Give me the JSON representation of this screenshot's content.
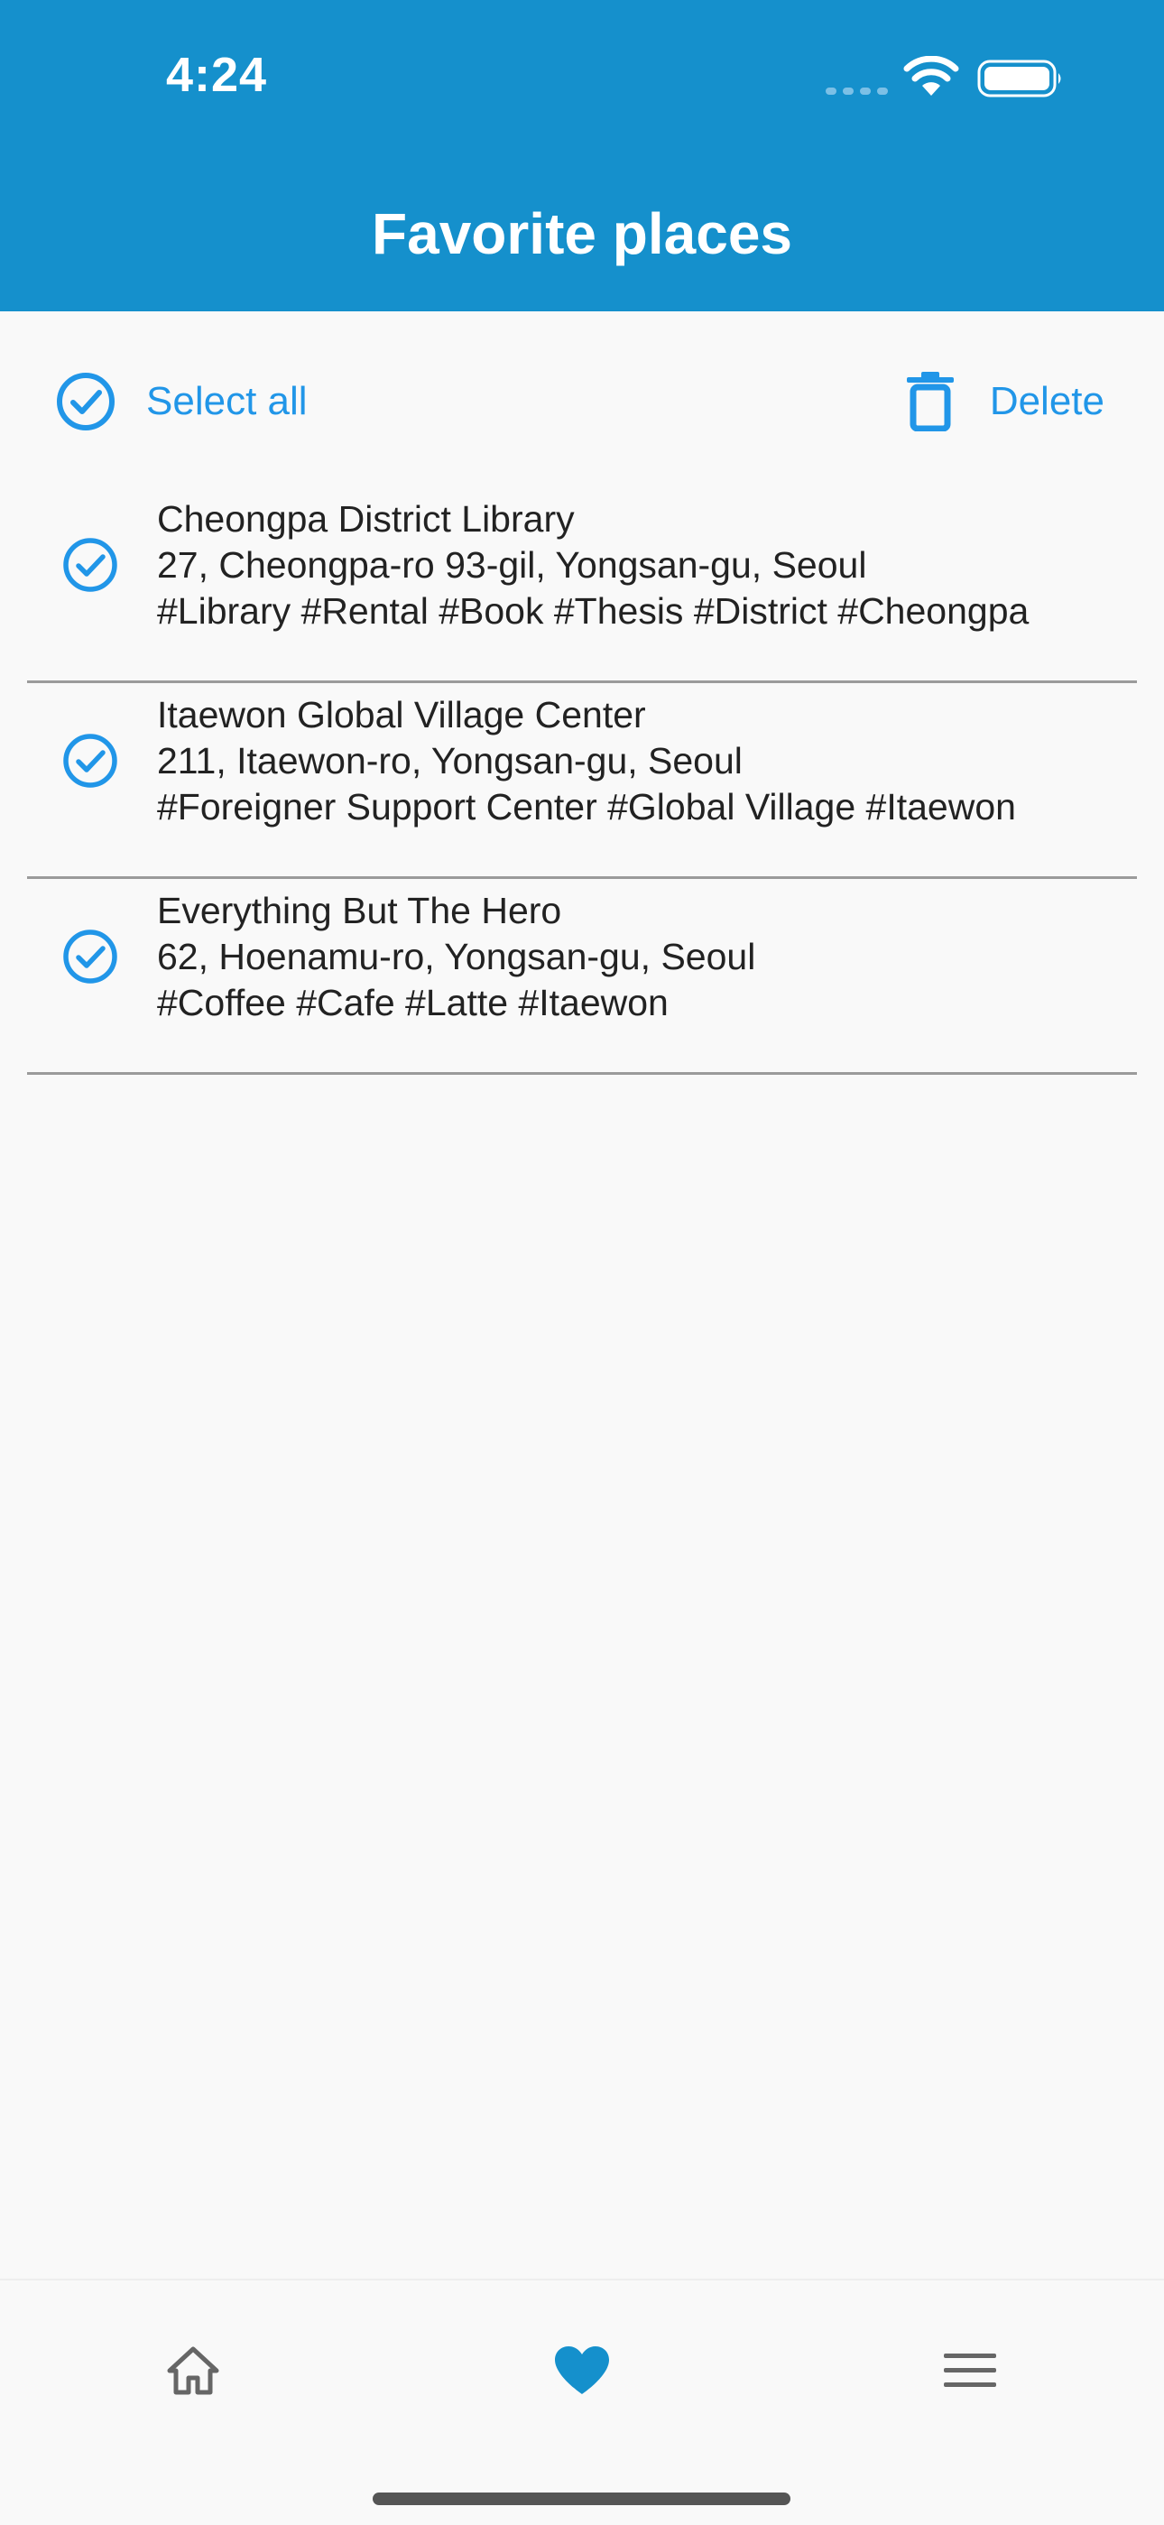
{
  "status_bar": {
    "time": "4:24"
  },
  "header": {
    "title": "Favorite places"
  },
  "toolbar": {
    "select_all_label": "Select all",
    "delete_label": "Delete"
  },
  "places": [
    {
      "name": "Cheongpa District Library",
      "address": "27, Cheongpa-ro 93-gil, Yongsan-gu, Seoul",
      "tags": "#Library #Rental #Book #Thesis #District #Cheongpa",
      "selected": true
    },
    {
      "name": "Itaewon Global Village Center",
      "address": "211, Itaewon-ro, Yongsan-gu, Seoul",
      "tags": "#Foreigner Support Center #Global Village #Itaewon",
      "selected": true
    },
    {
      "name": "Everything But The Hero",
      "address": "62, Hoenamu-ro, Yongsan-gu, Seoul",
      "tags": "#Coffee #Cafe #Latte #Itaewon",
      "selected": true
    }
  ],
  "bottom_nav": {
    "items": [
      {
        "icon": "home-icon",
        "active": false
      },
      {
        "icon": "heart-icon",
        "active": true
      },
      {
        "icon": "menu-icon",
        "active": false
      }
    ]
  },
  "colors": {
    "header_bg": "#1590cc",
    "accent": "#2196e8",
    "text": "#222222",
    "divider": "#9b9b9b",
    "nav_inactive": "#666666",
    "nav_active": "#1590cc"
  }
}
